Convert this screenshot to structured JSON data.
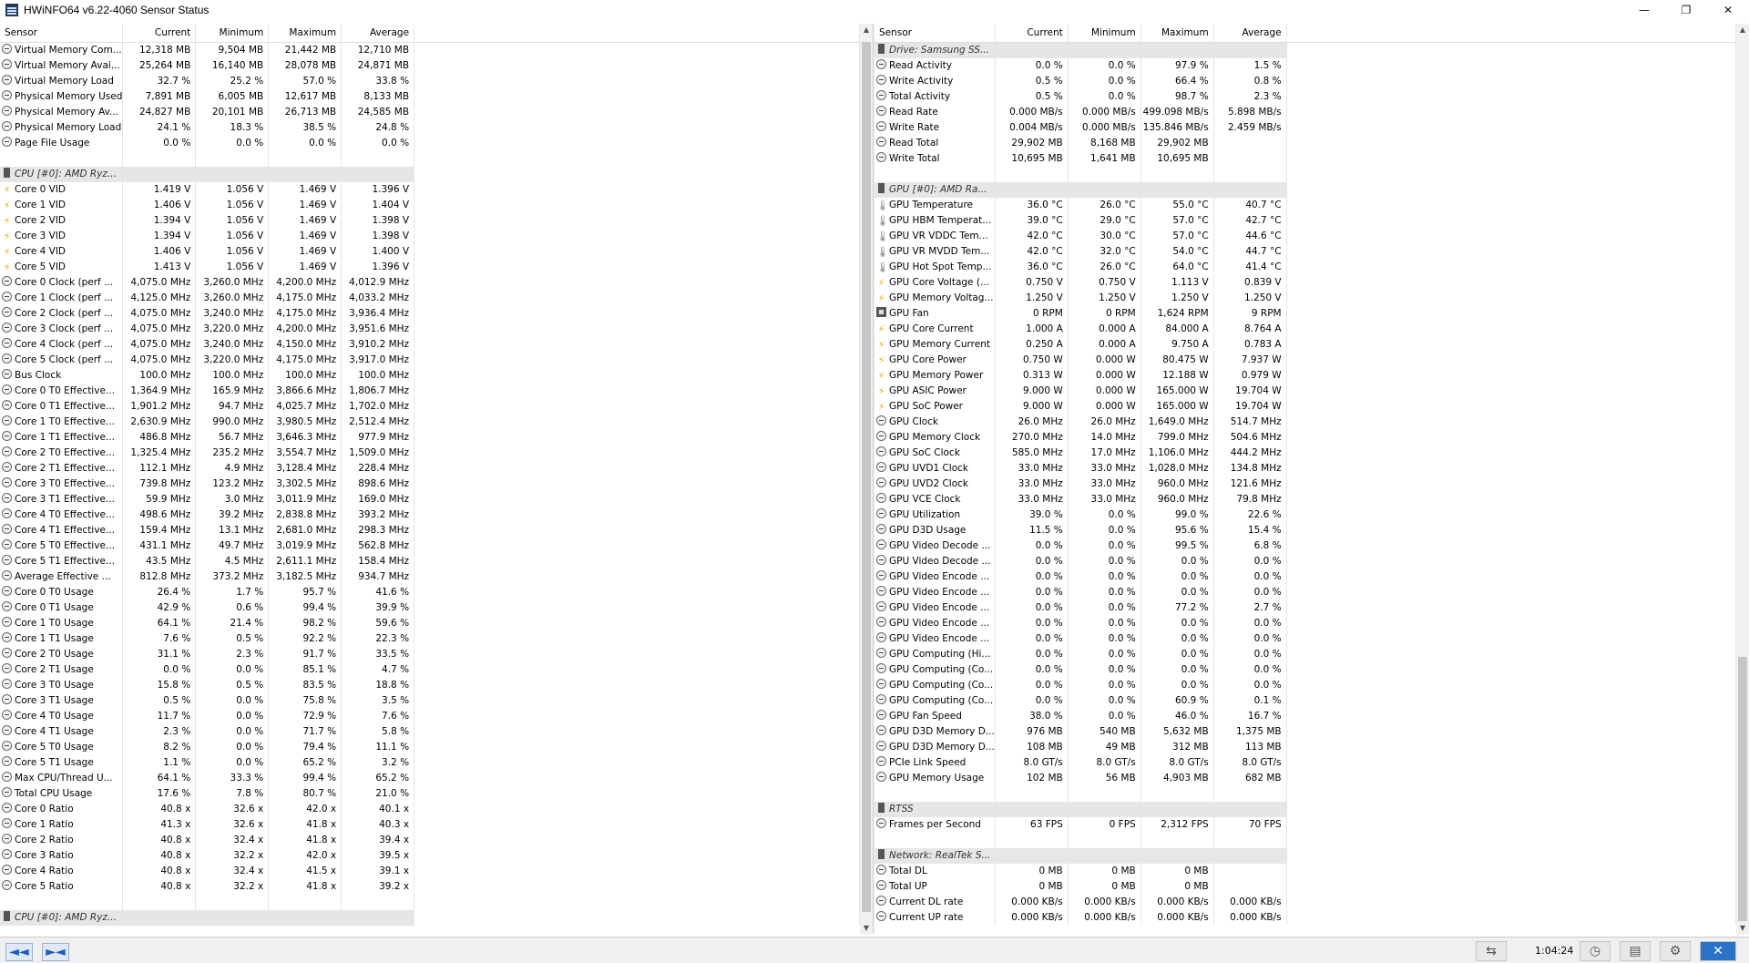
{
  "window": {
    "title": "HWiNFO64 v6.22-4060 Sensor Status",
    "controls": {
      "minimize": "—",
      "maximize": "❐",
      "close": "✕"
    }
  },
  "columns": {
    "sensor": "Sensor",
    "current": "Current",
    "minimum": "Minimum",
    "maximum": "Maximum",
    "average": "Average"
  },
  "left_rows": [
    {
      "icon": "circle",
      "name": "Virtual Memory Com...",
      "cur": "12,318 MB",
      "min": "9,504 MB",
      "max": "21,442 MB",
      "avg": "12,710 MB"
    },
    {
      "icon": "circle",
      "name": "Virtual Memory Avai...",
      "cur": "25,264 MB",
      "min": "16,140 MB",
      "max": "28,078 MB",
      "avg": "24,871 MB"
    },
    {
      "icon": "circle",
      "name": "Virtual Memory Load",
      "cur": "32.7 %",
      "min": "25.2 %",
      "max": "57.0 %",
      "avg": "33.8 %"
    },
    {
      "icon": "circle",
      "name": "Physical Memory Used",
      "cur": "7,891 MB",
      "min": "6,005 MB",
      "max": "12,617 MB",
      "avg": "8,133 MB"
    },
    {
      "icon": "circle",
      "name": "Physical Memory Av...",
      "cur": "24,827 MB",
      "min": "20,101 MB",
      "max": "26,713 MB",
      "avg": "24,585 MB"
    },
    {
      "icon": "circle",
      "name": "Physical Memory Load",
      "cur": "24.1 %",
      "min": "18.3 %",
      "max": "38.5 %",
      "avg": "24.8 %"
    },
    {
      "icon": "circle",
      "name": "Page File Usage",
      "cur": "0.0 %",
      "min": "0.0 %",
      "max": "0.0 %",
      "avg": "0.0 %"
    },
    {
      "type": "spacer"
    },
    {
      "type": "group",
      "name": "CPU [#0]: AMD Ryz..."
    },
    {
      "icon": "bolt",
      "name": "Core 0 VID",
      "cur": "1.419 V",
      "min": "1.056 V",
      "max": "1.469 V",
      "avg": "1.396 V"
    },
    {
      "icon": "bolt",
      "name": "Core 1 VID",
      "cur": "1.406 V",
      "min": "1.056 V",
      "max": "1.469 V",
      "avg": "1.404 V"
    },
    {
      "icon": "bolt",
      "name": "Core 2 VID",
      "cur": "1.394 V",
      "min": "1.056 V",
      "max": "1.469 V",
      "avg": "1.398 V"
    },
    {
      "icon": "bolt",
      "name": "Core 3 VID",
      "cur": "1.394 V",
      "min": "1.056 V",
      "max": "1.469 V",
      "avg": "1.398 V"
    },
    {
      "icon": "bolt",
      "name": "Core 4 VID",
      "cur": "1.406 V",
      "min": "1.056 V",
      "max": "1.469 V",
      "avg": "1.400 V"
    },
    {
      "icon": "bolt",
      "name": "Core 5 VID",
      "cur": "1.413 V",
      "min": "1.056 V",
      "max": "1.469 V",
      "avg": "1.396 V"
    },
    {
      "icon": "circle",
      "name": "Core 0 Clock (perf ...",
      "cur": "4,075.0 MHz",
      "min": "3,260.0 MHz",
      "max": "4,200.0 MHz",
      "avg": "4,012.9 MHz"
    },
    {
      "icon": "circle",
      "name": "Core 1 Clock (perf ...",
      "cur": "4,125.0 MHz",
      "min": "3,260.0 MHz",
      "max": "4,175.0 MHz",
      "avg": "4,033.2 MHz"
    },
    {
      "icon": "circle",
      "name": "Core 2 Clock (perf ...",
      "cur": "4,075.0 MHz",
      "min": "3,240.0 MHz",
      "max": "4,175.0 MHz",
      "avg": "3,936.4 MHz"
    },
    {
      "icon": "circle",
      "name": "Core 3 Clock (perf ...",
      "cur": "4,075.0 MHz",
      "min": "3,220.0 MHz",
      "max": "4,200.0 MHz",
      "avg": "3,951.6 MHz"
    },
    {
      "icon": "circle",
      "name": "Core 4 Clock (perf ...",
      "cur": "4,075.0 MHz",
      "min": "3,240.0 MHz",
      "max": "4,150.0 MHz",
      "avg": "3,910.2 MHz"
    },
    {
      "icon": "circle",
      "name": "Core 5 Clock (perf ...",
      "cur": "4,075.0 MHz",
      "min": "3,220.0 MHz",
      "max": "4,175.0 MHz",
      "avg": "3,917.0 MHz"
    },
    {
      "icon": "circle",
      "name": "Bus Clock",
      "cur": "100.0 MHz",
      "min": "100.0 MHz",
      "max": "100.0 MHz",
      "avg": "100.0 MHz"
    },
    {
      "icon": "circle",
      "name": "Core 0 T0 Effective...",
      "cur": "1,364.9 MHz",
      "min": "165.9 MHz",
      "max": "3,866.6 MHz",
      "avg": "1,806.7 MHz"
    },
    {
      "icon": "circle",
      "name": "Core 0 T1 Effective...",
      "cur": "1,901.2 MHz",
      "min": "94.7 MHz",
      "max": "4,025.7 MHz",
      "avg": "1,702.0 MHz"
    },
    {
      "icon": "circle",
      "name": "Core 1 T0 Effective...",
      "cur": "2,630.9 MHz",
      "min": "990.0 MHz",
      "max": "3,980.5 MHz",
      "avg": "2,512.4 MHz"
    },
    {
      "icon": "circle",
      "name": "Core 1 T1 Effective...",
      "cur": "486.8 MHz",
      "min": "56.7 MHz",
      "max": "3,646.3 MHz",
      "avg": "977.9 MHz"
    },
    {
      "icon": "circle",
      "name": "Core 2 T0 Effective...",
      "cur": "1,325.4 MHz",
      "min": "235.2 MHz",
      "max": "3,554.7 MHz",
      "avg": "1,509.0 MHz"
    },
    {
      "icon": "circle",
      "name": "Core 2 T1 Effective...",
      "cur": "112.1 MHz",
      "min": "4.9 MHz",
      "max": "3,128.4 MHz",
      "avg": "228.4 MHz"
    },
    {
      "icon": "circle",
      "name": "Core 3 T0 Effective...",
      "cur": "739.8 MHz",
      "min": "123.2 MHz",
      "max": "3,302.5 MHz",
      "avg": "898.6 MHz"
    },
    {
      "icon": "circle",
      "name": "Core 3 T1 Effective...",
      "cur": "59.9 MHz",
      "min": "3.0 MHz",
      "max": "3,011.9 MHz",
      "avg": "169.0 MHz"
    },
    {
      "icon": "circle",
      "name": "Core 4 T0 Effective...",
      "cur": "498.6 MHz",
      "min": "39.2 MHz",
      "max": "2,838.8 MHz",
      "avg": "393.2 MHz"
    },
    {
      "icon": "circle",
      "name": "Core 4 T1 Effective...",
      "cur": "159.4 MHz",
      "min": "13.1 MHz",
      "max": "2,681.0 MHz",
      "avg": "298.3 MHz"
    },
    {
      "icon": "circle",
      "name": "Core 5 T0 Effective...",
      "cur": "431.1 MHz",
      "min": "49.7 MHz",
      "max": "3,019.9 MHz",
      "avg": "562.8 MHz"
    },
    {
      "icon": "circle",
      "name": "Core 5 T1 Effective...",
      "cur": "43.5 MHz",
      "min": "4.5 MHz",
      "max": "2,611.1 MHz",
      "avg": "158.4 MHz"
    },
    {
      "icon": "circle",
      "name": "Average Effective ...",
      "cur": "812.8 MHz",
      "min": "373.2 MHz",
      "max": "3,182.5 MHz",
      "avg": "934.7 MHz"
    },
    {
      "icon": "circle",
      "name": "Core 0 T0 Usage",
      "cur": "26.4 %",
      "min": "1.7 %",
      "max": "95.7 %",
      "avg": "41.6 %"
    },
    {
      "icon": "circle",
      "name": "Core 0 T1 Usage",
      "cur": "42.9 %",
      "min": "0.6 %",
      "max": "99.4 %",
      "avg": "39.9 %"
    },
    {
      "icon": "circle",
      "name": "Core 1 T0 Usage",
      "cur": "64.1 %",
      "min": "21.4 %",
      "max": "98.2 %",
      "avg": "59.6 %"
    },
    {
      "icon": "circle",
      "name": "Core 1 T1 Usage",
      "cur": "7.6 %",
      "min": "0.5 %",
      "max": "92.2 %",
      "avg": "22.3 %"
    },
    {
      "icon": "circle",
      "name": "Core 2 T0 Usage",
      "cur": "31.1 %",
      "min": "2.3 %",
      "max": "91.7 %",
      "avg": "33.5 %"
    },
    {
      "icon": "circle",
      "name": "Core 2 T1 Usage",
      "cur": "0.0 %",
      "min": "0.0 %",
      "max": "85.1 %",
      "avg": "4.7 %"
    },
    {
      "icon": "circle",
      "name": "Core 3 T0 Usage",
      "cur": "15.8 %",
      "min": "0.5 %",
      "max": "83.5 %",
      "avg": "18.8 %"
    },
    {
      "icon": "circle",
      "name": "Core 3 T1 Usage",
      "cur": "0.5 %",
      "min": "0.0 %",
      "max": "75.8 %",
      "avg": "3.5 %"
    },
    {
      "icon": "circle",
      "name": "Core 4 T0 Usage",
      "cur": "11.7 %",
      "min": "0.0 %",
      "max": "72.9 %",
      "avg": "7.6 %"
    },
    {
      "icon": "circle",
      "name": "Core 4 T1 Usage",
      "cur": "2.3 %",
      "min": "0.0 %",
      "max": "71.7 %",
      "avg": "5.8 %"
    },
    {
      "icon": "circle",
      "name": "Core 5 T0 Usage",
      "cur": "8.2 %",
      "min": "0.0 %",
      "max": "79.4 %",
      "avg": "11.1 %"
    },
    {
      "icon": "circle",
      "name": "Core 5 T1 Usage",
      "cur": "1.1 %",
      "min": "0.0 %",
      "max": "65.2 %",
      "avg": "3.2 %"
    },
    {
      "icon": "circle",
      "name": "Max CPU/Thread U...",
      "cur": "64.1 %",
      "min": "33.3 %",
      "max": "99.4 %",
      "avg": "65.2 %"
    },
    {
      "icon": "circle",
      "name": "Total CPU Usage",
      "cur": "17.6 %",
      "min": "7.8 %",
      "max": "80.7 %",
      "avg": "21.0 %"
    },
    {
      "icon": "circle",
      "name": "Core 0 Ratio",
      "cur": "40.8 x",
      "min": "32.6 x",
      "max": "42.0 x",
      "avg": "40.1 x"
    },
    {
      "icon": "circle",
      "name": "Core 1 Ratio",
      "cur": "41.3 x",
      "min": "32.6 x",
      "max": "41.8 x",
      "avg": "40.3 x"
    },
    {
      "icon": "circle",
      "name": "Core 2 Ratio",
      "cur": "40.8 x",
      "min": "32.4 x",
      "max": "41.8 x",
      "avg": "39.4 x"
    },
    {
      "icon": "circle",
      "name": "Core 3 Ratio",
      "cur": "40.8 x",
      "min": "32.2 x",
      "max": "42.0 x",
      "avg": "39.5 x"
    },
    {
      "icon": "circle",
      "name": "Core 4 Ratio",
      "cur": "40.8 x",
      "min": "32.4 x",
      "max": "41.5 x",
      "avg": "39.1 x"
    },
    {
      "icon": "circle",
      "name": "Core 5 Ratio",
      "cur": "40.8 x",
      "min": "32.2 x",
      "max": "41.8 x",
      "avg": "39.2 x"
    },
    {
      "type": "spacer"
    },
    {
      "type": "group",
      "name": "CPU [#0]: AMD Ryz..."
    }
  ],
  "right_rows": [
    {
      "type": "group",
      "name": "Drive: Samsung SS..."
    },
    {
      "icon": "circle",
      "name": "Read Activity",
      "cur": "0.0 %",
      "min": "0.0 %",
      "max": "97.9 %",
      "avg": "1.5 %"
    },
    {
      "icon": "circle",
      "name": "Write Activity",
      "cur": "0.5 %",
      "min": "0.0 %",
      "max": "66.4 %",
      "avg": "0.8 %"
    },
    {
      "icon": "circle",
      "name": "Total Activity",
      "cur": "0.5 %",
      "min": "0.0 %",
      "max": "98.7 %",
      "avg": "2.3 %"
    },
    {
      "icon": "circle",
      "name": "Read Rate",
      "cur": "0.000 MB/s",
      "min": "0.000 MB/s",
      "max": "499.098 MB/s",
      "avg": "5.898 MB/s"
    },
    {
      "icon": "circle",
      "name": "Write Rate",
      "cur": "0.004 MB/s",
      "min": "0.000 MB/s",
      "max": "135.846 MB/s",
      "avg": "2.459 MB/s"
    },
    {
      "icon": "circle",
      "name": "Read Total",
      "cur": "29,902 MB",
      "min": "8,168 MB",
      "max": "29,902 MB",
      "avg": ""
    },
    {
      "icon": "circle",
      "name": "Write Total",
      "cur": "10,695 MB",
      "min": "1,641 MB",
      "max": "10,695 MB",
      "avg": ""
    },
    {
      "type": "spacer"
    },
    {
      "type": "group",
      "name": "GPU [#0]: AMD Ra..."
    },
    {
      "icon": "therm",
      "name": "GPU Temperature",
      "cur": "36.0 °C",
      "min": "26.0 °C",
      "max": "55.0 °C",
      "avg": "40.7 °C"
    },
    {
      "icon": "therm",
      "name": "GPU HBM Temperat...",
      "cur": "39.0 °C",
      "min": "29.0 °C",
      "max": "57.0 °C",
      "avg": "42.7 °C"
    },
    {
      "icon": "therm",
      "name": "GPU VR VDDC Tem...",
      "cur": "42.0 °C",
      "min": "30.0 °C",
      "max": "57.0 °C",
      "avg": "44.6 °C"
    },
    {
      "icon": "therm",
      "name": "GPU VR MVDD Tem...",
      "cur": "42.0 °C",
      "min": "32.0 °C",
      "max": "54.0 °C",
      "avg": "44.7 °C"
    },
    {
      "icon": "therm",
      "name": "GPU Hot Spot Temp...",
      "cur": "36.0 °C",
      "min": "26.0 °C",
      "max": "64.0 °C",
      "avg": "41.4 °C"
    },
    {
      "icon": "bolt",
      "name": "GPU Core Voltage (...",
      "cur": "0.750 V",
      "min": "0.750 V",
      "max": "1.113 V",
      "avg": "0.839 V"
    },
    {
      "icon": "bolt",
      "name": "GPU Memory Voltag...",
      "cur": "1.250 V",
      "min": "1.250 V",
      "max": "1.250 V",
      "avg": "1.250 V"
    },
    {
      "icon": "fan",
      "name": "GPU Fan",
      "cur": "0 RPM",
      "min": "0 RPM",
      "max": "1,624 RPM",
      "avg": "9 RPM"
    },
    {
      "icon": "bolt",
      "name": "GPU Core Current",
      "cur": "1.000 A",
      "min": "0.000 A",
      "max": "84.000 A",
      "avg": "8.764 A"
    },
    {
      "icon": "bolt",
      "name": "GPU Memory Current",
      "cur": "0.250 A",
      "min": "0.000 A",
      "max": "9.750 A",
      "avg": "0.783 A"
    },
    {
      "icon": "bolt",
      "name": "GPU Core Power",
      "cur": "0.750 W",
      "min": "0.000 W",
      "max": "80.475 W",
      "avg": "7.937 W"
    },
    {
      "icon": "bolt",
      "name": "GPU Memory Power",
      "cur": "0.313 W",
      "min": "0.000 W",
      "max": "12.188 W",
      "avg": "0.979 W"
    },
    {
      "icon": "bolt",
      "name": "GPU ASIC Power",
      "cur": "9.000 W",
      "min": "0.000 W",
      "max": "165.000 W",
      "avg": "19.704 W"
    },
    {
      "icon": "bolt",
      "name": "GPU SoC Power",
      "cur": "9.000 W",
      "min": "0.000 W",
      "max": "165.000 W",
      "avg": "19.704 W"
    },
    {
      "icon": "circle",
      "name": "GPU Clock",
      "cur": "26.0 MHz",
      "min": "26.0 MHz",
      "max": "1,649.0 MHz",
      "avg": "514.7 MHz"
    },
    {
      "icon": "circle",
      "name": "GPU Memory Clock",
      "cur": "270.0 MHz",
      "min": "14.0 MHz",
      "max": "799.0 MHz",
      "avg": "504.6 MHz"
    },
    {
      "icon": "circle",
      "name": "GPU SoC Clock",
      "cur": "585.0 MHz",
      "min": "17.0 MHz",
      "max": "1,106.0 MHz",
      "avg": "444.2 MHz"
    },
    {
      "icon": "circle",
      "name": "GPU UVD1 Clock",
      "cur": "33.0 MHz",
      "min": "33.0 MHz",
      "max": "1,028.0 MHz",
      "avg": "134.8 MHz"
    },
    {
      "icon": "circle",
      "name": "GPU UVD2 Clock",
      "cur": "33.0 MHz",
      "min": "33.0 MHz",
      "max": "960.0 MHz",
      "avg": "121.6 MHz"
    },
    {
      "icon": "circle",
      "name": "GPU VCE Clock",
      "cur": "33.0 MHz",
      "min": "33.0 MHz",
      "max": "960.0 MHz",
      "avg": "79.8 MHz"
    },
    {
      "icon": "circle",
      "name": "GPU Utilization",
      "cur": "39.0 %",
      "min": "0.0 %",
      "max": "99.0 %",
      "avg": "22.6 %"
    },
    {
      "icon": "circle",
      "name": "GPU D3D Usage",
      "cur": "11.5 %",
      "min": "0.0 %",
      "max": "95.6 %",
      "avg": "15.4 %"
    },
    {
      "icon": "circle",
      "name": "GPU Video Decode ...",
      "cur": "0.0 %",
      "min": "0.0 %",
      "max": "99.5 %",
      "avg": "6.8 %"
    },
    {
      "icon": "circle",
      "name": "GPU Video Decode ...",
      "cur": "0.0 %",
      "min": "0.0 %",
      "max": "0.0 %",
      "avg": "0.0 %"
    },
    {
      "icon": "circle",
      "name": "GPU Video Encode ...",
      "cur": "0.0 %",
      "min": "0.0 %",
      "max": "0.0 %",
      "avg": "0.0 %"
    },
    {
      "icon": "circle",
      "name": "GPU Video Encode ...",
      "cur": "0.0 %",
      "min": "0.0 %",
      "max": "0.0 %",
      "avg": "0.0 %"
    },
    {
      "icon": "circle",
      "name": "GPU Video Encode ...",
      "cur": "0.0 %",
      "min": "0.0 %",
      "max": "77.2 %",
      "avg": "2.7 %"
    },
    {
      "icon": "circle",
      "name": "GPU Video Encode ...",
      "cur": "0.0 %",
      "min": "0.0 %",
      "max": "0.0 %",
      "avg": "0.0 %"
    },
    {
      "icon": "circle",
      "name": "GPU Video Encode ...",
      "cur": "0.0 %",
      "min": "0.0 %",
      "max": "0.0 %",
      "avg": "0.0 %"
    },
    {
      "icon": "circle",
      "name": "GPU Computing (Hi...",
      "cur": "0.0 %",
      "min": "0.0 %",
      "max": "0.0 %",
      "avg": "0.0 %"
    },
    {
      "icon": "circle",
      "name": "GPU Computing (Co...",
      "cur": "0.0 %",
      "min": "0.0 %",
      "max": "0.0 %",
      "avg": "0.0 %"
    },
    {
      "icon": "circle",
      "name": "GPU Computing (Co...",
      "cur": "0.0 %",
      "min": "0.0 %",
      "max": "0.0 %",
      "avg": "0.0 %"
    },
    {
      "icon": "circle",
      "name": "GPU Computing (Co...",
      "cur": "0.0 %",
      "min": "0.0 %",
      "max": "60.9 %",
      "avg": "0.1 %"
    },
    {
      "icon": "circle",
      "name": "GPU Fan Speed",
      "cur": "38.0 %",
      "min": "0.0 %",
      "max": "46.0 %",
      "avg": "16.7 %"
    },
    {
      "icon": "circle",
      "name": "GPU D3D Memory D...",
      "cur": "976 MB",
      "min": "540 MB",
      "max": "5,632 MB",
      "avg": "1,375 MB"
    },
    {
      "icon": "circle",
      "name": "GPU D3D Memory D...",
      "cur": "108 MB",
      "min": "49 MB",
      "max": "312 MB",
      "avg": "113 MB"
    },
    {
      "icon": "circle",
      "name": "PCIe Link Speed",
      "cur": "8.0 GT/s",
      "min": "8.0 GT/s",
      "max": "8.0 GT/s",
      "avg": "8.0 GT/s"
    },
    {
      "icon": "circle",
      "name": "GPU Memory Usage",
      "cur": "102 MB",
      "min": "56 MB",
      "max": "4,903 MB",
      "avg": "682 MB"
    },
    {
      "type": "spacer"
    },
    {
      "type": "group",
      "name": "RTSS"
    },
    {
      "icon": "circle",
      "name": "Frames per Second",
      "cur": "63 FPS",
      "min": "0 FPS",
      "max": "2,312 FPS",
      "avg": "70 FPS"
    },
    {
      "type": "spacer"
    },
    {
      "type": "group",
      "name": "Network: RealTek S..."
    },
    {
      "icon": "circle",
      "name": "Total DL",
      "cur": "0 MB",
      "min": "0 MB",
      "max": "0 MB",
      "avg": ""
    },
    {
      "icon": "circle",
      "name": "Total UP",
      "cur": "0 MB",
      "min": "0 MB",
      "max": "0 MB",
      "avg": ""
    },
    {
      "icon": "circle",
      "name": "Current DL rate",
      "cur": "0.000 KB/s",
      "min": "0.000 KB/s",
      "max": "0.000 KB/s",
      "avg": "0.000 KB/s"
    },
    {
      "icon": "circle",
      "name": "Current UP rate",
      "cur": "0.000 KB/s",
      "min": "0.000 KB/s",
      "max": "0.000 KB/s",
      "avg": "0.000 KB/s"
    }
  ],
  "statusbar": {
    "back_label": "◄◄",
    "forward_label": "►◄",
    "elapsed_time": "1:04:24"
  }
}
